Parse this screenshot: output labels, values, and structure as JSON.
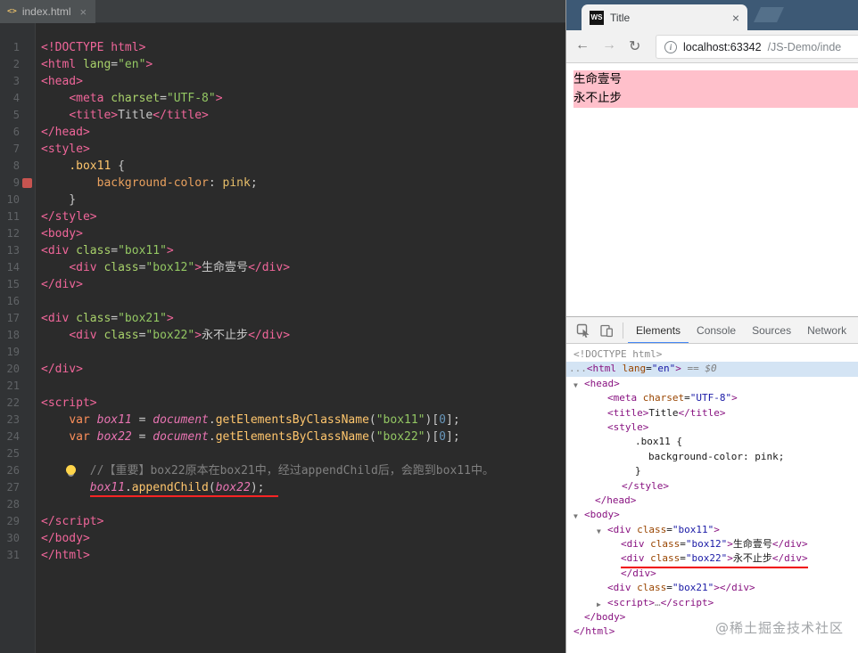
{
  "palette": {
    "editor_bg": "#2b2b2b",
    "gutter_bg": "#313335",
    "tag_pink": "#f0669a",
    "string_green": "#93c763",
    "keyword_orange": "#fc8f5a",
    "comment_gray": "#808080",
    "page_pink": "#ffc0cb",
    "titlebar_blue": "#3d5975",
    "devtools_tag_purple": "#881280",
    "devtools_attr_orange": "#994500",
    "devtools_value_blue": "#1a1aa6",
    "devtools_accent_blue": "#4285f4",
    "annotation_red": "#ff2424",
    "breakpoint_red": "#c75450"
  },
  "editor": {
    "tab": {
      "icon_glyph": "<>",
      "filename": "index.html",
      "close_glyph": "×"
    },
    "lines": [
      {
        "n": 1,
        "tokens": [
          {
            "t": "<!DOCTYPE html>",
            "c": "tag"
          }
        ]
      },
      {
        "n": 2,
        "tokens": [
          {
            "t": "<html ",
            "c": "tag"
          },
          {
            "t": "lang",
            "c": "attr"
          },
          {
            "t": "=",
            "c": "text"
          },
          {
            "t": "\"en\"",
            "c": "str"
          },
          {
            "t": ">",
            "c": "tag"
          }
        ]
      },
      {
        "n": 3,
        "tokens": [
          {
            "t": "<head>",
            "c": "tag"
          }
        ]
      },
      {
        "n": 4,
        "tokens": [
          {
            "t": "    ",
            "c": "text"
          },
          {
            "t": "<meta ",
            "c": "tag"
          },
          {
            "t": "charset",
            "c": "attr"
          },
          {
            "t": "=",
            "c": "text"
          },
          {
            "t": "\"UTF-8\"",
            "c": "str"
          },
          {
            "t": ">",
            "c": "tag"
          }
        ]
      },
      {
        "n": 5,
        "tokens": [
          {
            "t": "    ",
            "c": "text"
          },
          {
            "t": "<title>",
            "c": "tag"
          },
          {
            "t": "Title",
            "c": "text"
          },
          {
            "t": "</title>",
            "c": "tag"
          }
        ]
      },
      {
        "n": 6,
        "tokens": [
          {
            "t": "</head>",
            "c": "tag"
          }
        ]
      },
      {
        "n": 7,
        "tokens": [
          {
            "t": "<style>",
            "c": "tag"
          }
        ]
      },
      {
        "n": 8,
        "tokens": [
          {
            "t": "    ",
            "c": "text"
          },
          {
            "t": ".box11",
            "c": "cssSel"
          },
          {
            "t": " {",
            "c": "text"
          }
        ]
      },
      {
        "n": 9,
        "bp": true,
        "tokens": [
          {
            "t": "        ",
            "c": "text"
          },
          {
            "t": "background-color",
            "c": "cssProp"
          },
          {
            "t": ": ",
            "c": "text"
          },
          {
            "t": "pink",
            "c": "cssVal"
          },
          {
            "t": ";",
            "c": "text"
          }
        ]
      },
      {
        "n": 10,
        "tokens": [
          {
            "t": "    }",
            "c": "text"
          }
        ]
      },
      {
        "n": 11,
        "tokens": [
          {
            "t": "</style>",
            "c": "tag"
          }
        ]
      },
      {
        "n": 12,
        "tokens": [
          {
            "t": "<body>",
            "c": "tag"
          }
        ]
      },
      {
        "n": 13,
        "tokens": [
          {
            "t": "<div ",
            "c": "tag"
          },
          {
            "t": "class",
            "c": "attr"
          },
          {
            "t": "=",
            "c": "text"
          },
          {
            "t": "\"box11\"",
            "c": "str"
          },
          {
            "t": ">",
            "c": "tag"
          }
        ]
      },
      {
        "n": 14,
        "tokens": [
          {
            "t": "    ",
            "c": "text"
          },
          {
            "t": "<div ",
            "c": "tag"
          },
          {
            "t": "class",
            "c": "attr"
          },
          {
            "t": "=",
            "c": "text"
          },
          {
            "t": "\"box12\"",
            "c": "str"
          },
          {
            "t": ">",
            "c": "tag"
          },
          {
            "t": "生命壹号",
            "c": "text"
          },
          {
            "t": "</div>",
            "c": "tag"
          }
        ]
      },
      {
        "n": 15,
        "tokens": [
          {
            "t": "</div>",
            "c": "tag"
          }
        ]
      },
      {
        "n": 16,
        "tokens": []
      },
      {
        "n": 17,
        "tokens": [
          {
            "t": "<div ",
            "c": "tag"
          },
          {
            "t": "class",
            "c": "attr"
          },
          {
            "t": "=",
            "c": "text"
          },
          {
            "t": "\"box21\"",
            "c": "str"
          },
          {
            "t": ">",
            "c": "tag"
          }
        ]
      },
      {
        "n": 18,
        "tokens": [
          {
            "t": "    ",
            "c": "text"
          },
          {
            "t": "<div ",
            "c": "tag"
          },
          {
            "t": "class",
            "c": "attr"
          },
          {
            "t": "=",
            "c": "text"
          },
          {
            "t": "\"box22\"",
            "c": "str"
          },
          {
            "t": ">",
            "c": "tag"
          },
          {
            "t": "永不止步",
            "c": "text"
          },
          {
            "t": "</div>",
            "c": "tag"
          }
        ]
      },
      {
        "n": 19,
        "tokens": []
      },
      {
        "n": 20,
        "tokens": [
          {
            "t": "</div>",
            "c": "tag"
          }
        ]
      },
      {
        "n": 21,
        "tokens": []
      },
      {
        "n": 22,
        "tokens": [
          {
            "t": "<script>",
            "c": "tag"
          }
        ]
      },
      {
        "n": 23,
        "tokens": [
          {
            "t": "    ",
            "c": "text"
          },
          {
            "t": "var ",
            "c": "kw"
          },
          {
            "t": "box11",
            "c": "id"
          },
          {
            "t": " = ",
            "c": "text"
          },
          {
            "t": "document",
            "c": "id"
          },
          {
            "t": ".",
            "c": "text"
          },
          {
            "t": "getElementsByClassName",
            "c": "fn"
          },
          {
            "t": "(",
            "c": "text"
          },
          {
            "t": "\"box11\"",
            "c": "str"
          },
          {
            "t": ")[",
            "c": "text"
          },
          {
            "t": "0",
            "c": "num"
          },
          {
            "t": "];",
            "c": "text"
          }
        ]
      },
      {
        "n": 24,
        "tokens": [
          {
            "t": "    ",
            "c": "text"
          },
          {
            "t": "var ",
            "c": "kw"
          },
          {
            "t": "box22",
            "c": "id"
          },
          {
            "t": " = ",
            "c": "text"
          },
          {
            "t": "document",
            "c": "id"
          },
          {
            "t": ".",
            "c": "text"
          },
          {
            "t": "getElementsByClassName",
            "c": "fn"
          },
          {
            "t": "(",
            "c": "text"
          },
          {
            "t": "\"box22\"",
            "c": "str"
          },
          {
            "t": ")[",
            "c": "text"
          },
          {
            "t": "0",
            "c": "num"
          },
          {
            "t": "];",
            "c": "text"
          }
        ]
      },
      {
        "n": 25,
        "tokens": []
      },
      {
        "n": 26,
        "bulb": true,
        "tokens": [
          {
            "t": "       ",
            "c": "text"
          },
          {
            "t": "//【重要】box22原本在box21中，经过appendChild后，会跑到box11中。",
            "c": "com"
          }
        ]
      },
      {
        "n": 27,
        "redline": true,
        "redline_from": 1,
        "tokens": [
          {
            "t": "       ",
            "c": "text"
          },
          {
            "t": "box11",
            "c": "id"
          },
          {
            "t": ".",
            "c": "text"
          },
          {
            "t": "appendChild",
            "c": "fn"
          },
          {
            "t": "(",
            "c": "text"
          },
          {
            "t": "box22",
            "c": "id"
          },
          {
            "t": ");",
            "c": "text"
          }
        ]
      },
      {
        "n": 28,
        "tokens": []
      },
      {
        "n": 29,
        "tokens": [
          {
            "t": "</script>",
            "c": "tag"
          }
        ]
      },
      {
        "n": 30,
        "tokens": [
          {
            "t": "</body>",
            "c": "tag"
          }
        ]
      },
      {
        "n": 31,
        "tokens": [
          {
            "t": "</html>",
            "c": "tag"
          }
        ]
      }
    ]
  },
  "browser": {
    "tab": {
      "favicon_text": "WS",
      "title": "Title",
      "close_glyph": "×"
    },
    "nav": {
      "back_glyph": "←",
      "forward_glyph": "→",
      "refresh_glyph": "↻",
      "info_glyph": "i"
    },
    "address": {
      "host": "localhost:63342",
      "path": "/JS-Demo/inde"
    },
    "page": {
      "pink": "#ffc0cb",
      "lines": [
        "生命壹号",
        "永不止步"
      ]
    },
    "devtools": {
      "tabs": [
        "Elements",
        "Console",
        "Sources",
        "Network"
      ],
      "active_tab": "Elements",
      "watermark": "@稀土掘金技术社区",
      "tree": [
        {
          "pad": 8,
          "tokens": [
            {
              "t": "<!DOCTYPE html>",
              "c": "gray"
            }
          ]
        },
        {
          "pad": 3,
          "sel": true,
          "tokens": [
            {
              "t": "...",
              "c": "gray"
            },
            {
              "t": "<html ",
              "c": "tag"
            },
            {
              "t": "lang",
              "c": "attr"
            },
            {
              "t": "=",
              "c": "plain"
            },
            {
              "t": "\"en\"",
              "c": "val"
            },
            {
              "t": ">",
              "c": "tag"
            },
            {
              "t": " == $0",
              "c": "grayi"
            }
          ]
        },
        {
          "pad": 20,
          "arrow": "▼",
          "tokens": [
            {
              "t": "<head>",
              "c": "tag"
            }
          ]
        },
        {
          "pad": 46,
          "tokens": [
            {
              "t": "<meta ",
              "c": "tag"
            },
            {
              "t": "charset",
              "c": "attr"
            },
            {
              "t": "=",
              "c": "plain"
            },
            {
              "t": "\"UTF-8\"",
              "c": "val"
            },
            {
              "t": ">",
              "c": "tag"
            }
          ]
        },
        {
          "pad": 46,
          "tokens": [
            {
              "t": "<title>",
              "c": "tag"
            },
            {
              "t": "Title",
              "c": "plain"
            },
            {
              "t": "</title>",
              "c": "tag"
            }
          ]
        },
        {
          "pad": 46,
          "tokens": [
            {
              "t": "<style>",
              "c": "tag"
            }
          ]
        },
        {
          "pad": 77,
          "tokens": [
            {
              "t": ".box11 {",
              "c": "plain"
            }
          ]
        },
        {
          "pad": 92,
          "tokens": [
            {
              "t": "background-color: pink;",
              "c": "plain"
            }
          ]
        },
        {
          "pad": 77,
          "tokens": [
            {
              "t": "}",
              "c": "plain"
            }
          ]
        },
        {
          "pad": 62,
          "tokens": [
            {
              "t": "</style>",
              "c": "tag"
            }
          ]
        },
        {
          "pad": 32,
          "tokens": [
            {
              "t": "</head>",
              "c": "tag"
            }
          ]
        },
        {
          "pad": 20,
          "arrow": "▼",
          "tokens": [
            {
              "t": "<body>",
              "c": "tag"
            }
          ]
        },
        {
          "pad": 46,
          "arrow": "▼",
          "tokens": [
            {
              "t": "<div ",
              "c": "tag"
            },
            {
              "t": "class",
              "c": "attr"
            },
            {
              "t": "=",
              "c": "plain"
            },
            {
              "t": "\"box11\"",
              "c": "val"
            },
            {
              "t": ">",
              "c": "tag"
            }
          ]
        },
        {
          "pad": 61,
          "tokens": [
            {
              "t": "<div ",
              "c": "tag"
            },
            {
              "t": "class",
              "c": "attr"
            },
            {
              "t": "=",
              "c": "plain"
            },
            {
              "t": "\"box12\"",
              "c": "val"
            },
            {
              "t": ">",
              "c": "tag"
            },
            {
              "t": "生命壹号",
              "c": "plain"
            },
            {
              "t": "</div>",
              "c": "tag"
            }
          ]
        },
        {
          "pad": 61,
          "redline": true,
          "tokens": [
            {
              "t": "<div ",
              "c": "tag"
            },
            {
              "t": "class",
              "c": "attr"
            },
            {
              "t": "=",
              "c": "plain"
            },
            {
              "t": "\"box22\"",
              "c": "val"
            },
            {
              "t": ">",
              "c": "tag"
            },
            {
              "t": "永不止步",
              "c": "plain"
            },
            {
              "t": "</div>",
              "c": "tag"
            }
          ]
        },
        {
          "pad": 61,
          "tokens": [
            {
              "t": "</div>",
              "c": "tag"
            }
          ]
        },
        {
          "pad": 46,
          "tokens": [
            {
              "t": "<div ",
              "c": "tag"
            },
            {
              "t": "class",
              "c": "attr"
            },
            {
              "t": "=",
              "c": "plain"
            },
            {
              "t": "\"box21\"",
              "c": "val"
            },
            {
              "t": ">",
              "c": "tag"
            },
            {
              "t": "</div>",
              "c": "tag"
            }
          ]
        },
        {
          "pad": 46,
          "arrow": "▶",
          "tokens": [
            {
              "t": "<script>",
              "c": "tag"
            },
            {
              "t": "…",
              "c": "gray"
            },
            {
              "t": "</script>",
              "c": "tag"
            }
          ]
        },
        {
          "pad": 20,
          "tokens": [
            {
              "t": "</body>",
              "c": "tag"
            }
          ]
        },
        {
          "pad": 8,
          "tokens": [
            {
              "t": "</html>",
              "c": "tag"
            }
          ]
        }
      ]
    }
  }
}
